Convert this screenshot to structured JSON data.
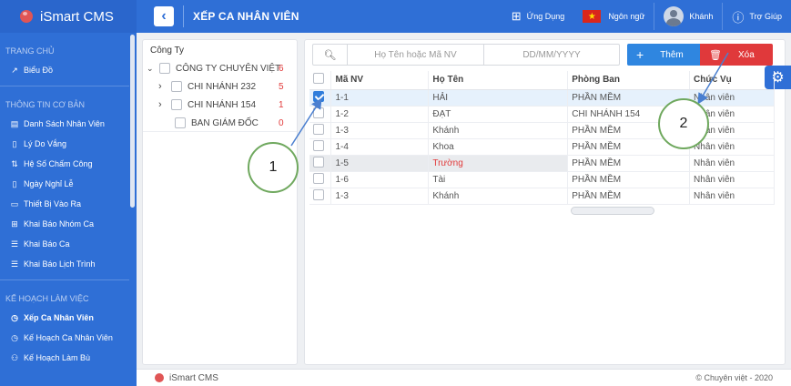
{
  "app": {
    "title": "iSmart CMS"
  },
  "sidebar": {
    "sections": [
      {
        "title": "TRANG CHỦ",
        "items": [
          {
            "label": "Biểu Đồ",
            "icon": "chart-icon"
          }
        ]
      },
      {
        "title": "THÔNG TIN CƠ BẢN",
        "items": [
          {
            "label": "Danh Sách Nhân Viên",
            "icon": "id-card-icon"
          },
          {
            "label": "Lý Do Vắng",
            "icon": "bookmark-icon"
          },
          {
            "label": "Hệ Số Chấm Công",
            "icon": "sort-icon"
          },
          {
            "label": "Ngày Nghỉ Lễ",
            "icon": "bookmark-icon"
          },
          {
            "label": "Thiết Bị Vào Ra",
            "icon": "tablet-icon"
          },
          {
            "label": "Khai Báo Nhóm Ca",
            "icon": "grid-icon"
          },
          {
            "label": "Khai Báo Ca",
            "icon": "list-icon"
          },
          {
            "label": "Khai Báo Lịch Trình",
            "icon": "list-icon"
          }
        ]
      },
      {
        "title": "KẾ HOẠCH LÀM VIỆC",
        "items": [
          {
            "label": "Xếp Ca Nhân Viên",
            "icon": "clock-icon"
          },
          {
            "label": "Kế Hoạch Ca Nhân Viên",
            "icon": "clock-icon"
          },
          {
            "label": "Kế Hoạch Làm Bù",
            "icon": "people-icon"
          }
        ]
      }
    ]
  },
  "header": {
    "title": "XẾP CA NHÂN VIÊN",
    "apps_label": "Ứng Dụng",
    "language_label": "Ngôn ngữ",
    "user_label": "Khánh",
    "help_label": "Trợ Giúp"
  },
  "tree": {
    "header": "Công Ty",
    "nodes": [
      {
        "label": "CÔNG TY CHUYÊN VIỆT",
        "count": "6"
      },
      {
        "label": "CHI NHÁNH 232",
        "count": "5"
      },
      {
        "label": "CHI NHÁNH 154",
        "count": "1"
      },
      {
        "label": "BAN GIÁM ĐỐC",
        "count": "0"
      }
    ]
  },
  "toolbar": {
    "search_placeholder": "Họ Tên hoặc Mã NV",
    "date_placeholder": "DD/MM/YYYY",
    "add_label": "Thêm",
    "delete_label": "Xóa"
  },
  "table": {
    "headers": [
      "Mã NV",
      "Họ Tên",
      "Phòng Ban",
      "Chức Vụ"
    ],
    "rows": [
      {
        "id": "1-1",
        "name": "HẢI",
        "dept": "PHẦN MỀM",
        "role": "Nhân viên",
        "checked": true
      },
      {
        "id": "1-2",
        "name": "ĐẠT",
        "dept": "CHI NHÁNH 154",
        "role": "Nhân viên",
        "checked": false
      },
      {
        "id": "1-3",
        "name": "Khánh",
        "dept": "PHẦN MỀM",
        "role": "Nhân viên",
        "checked": false
      },
      {
        "id": "1-4",
        "name": "Khoa",
        "dept": "PHẦN MỀM",
        "role": "Nhân viên",
        "checked": false
      },
      {
        "id": "1-5",
        "name": "Trường",
        "dept": "PHẦN MỀM",
        "role": "Nhân viên",
        "checked": false
      },
      {
        "id": "1-6",
        "name": "Tài",
        "dept": "PHẦN MỀM",
        "role": "Nhân viên",
        "checked": false
      },
      {
        "id": "1-3",
        "name": "Khánh",
        "dept": "PHẦN MỀM",
        "role": "Nhân viên",
        "checked": false
      }
    ]
  },
  "callouts": [
    "1",
    "2"
  ],
  "footer": {
    "brand": "iSmart CMS",
    "copyright": "© Chuyên việt - 2020"
  }
}
